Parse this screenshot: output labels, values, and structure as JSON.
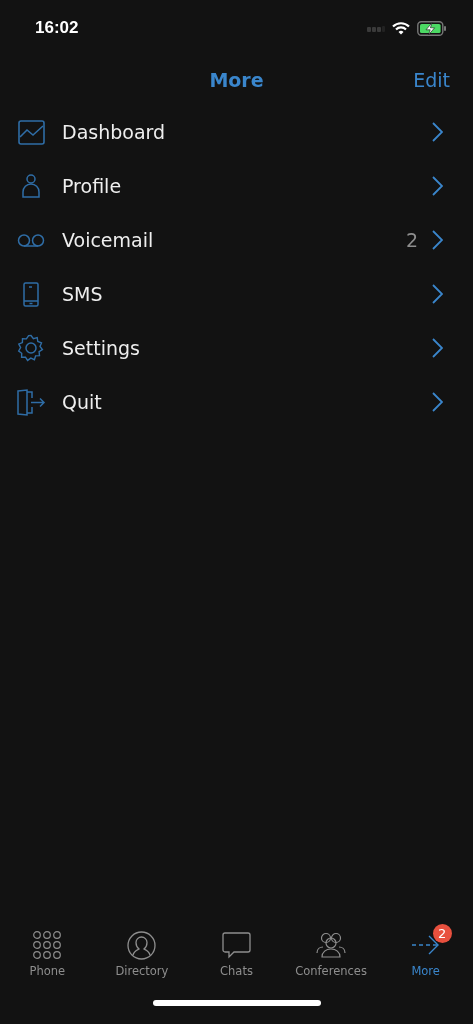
{
  "status_bar": {
    "time": "16:02",
    "charging": true
  },
  "nav_bar": {
    "title": "More",
    "action": "Edit"
  },
  "menu": [
    {
      "kind": "dashboard",
      "label": "Dashboard"
    },
    {
      "kind": "profile",
      "label": "Profile"
    },
    {
      "kind": "voicemail",
      "label": "Voicemail",
      "count": "2"
    },
    {
      "kind": "sms",
      "label": "SMS"
    },
    {
      "kind": "settings",
      "label": "Settings"
    },
    {
      "kind": "quit",
      "label": "Quit"
    }
  ],
  "tab_bar": [
    {
      "kind": "phone",
      "label": "Phone",
      "selected": false
    },
    {
      "kind": "directory",
      "label": "Directory",
      "selected": false
    },
    {
      "kind": "chats",
      "label": "Chats",
      "selected": false
    },
    {
      "kind": "conferences",
      "label": "Conferences",
      "selected": false
    },
    {
      "kind": "more",
      "label": "More",
      "selected": true,
      "badge": "2"
    }
  ]
}
